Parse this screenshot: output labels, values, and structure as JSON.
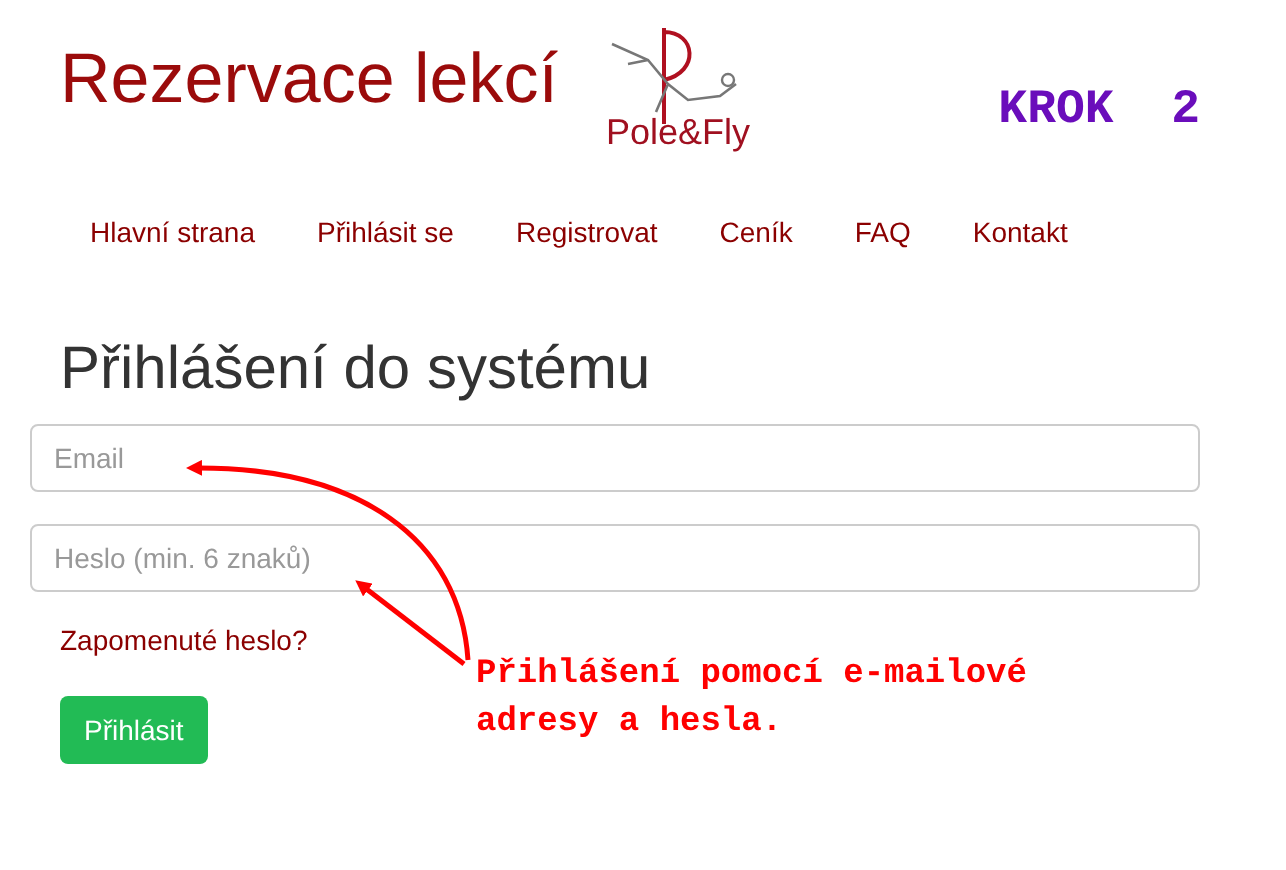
{
  "header": {
    "title": "Rezervace lekcí",
    "logo_text": "Pole&Fly",
    "step": "KROK  2"
  },
  "nav": [
    {
      "label": "Hlavní strana"
    },
    {
      "label": "Přihlásit se"
    },
    {
      "label": "Registrovat"
    },
    {
      "label": "Ceník"
    },
    {
      "label": "FAQ"
    },
    {
      "label": "Kontakt"
    }
  ],
  "form": {
    "heading": "Přihlášení do systému",
    "fields": [
      {
        "placeholder": "Email"
      },
      {
        "placeholder": "Heslo (min. 6 znaků)"
      }
    ],
    "forgot_link": "Zapomenuté heslo?",
    "submit": "Přihlásit"
  },
  "annotation": "Přihlášení pomocí e-mailové adresy a hesla."
}
